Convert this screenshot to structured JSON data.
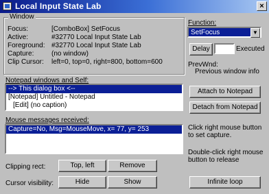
{
  "window": {
    "title": "Local Input State Lab",
    "close_glyph": "×"
  },
  "state_group": {
    "legend": "Window",
    "rows": [
      {
        "label": "Focus:",
        "value": "[ComboBox] SetFocus"
      },
      {
        "label": "Active:",
        "value": "#32770  Local Input State Lab"
      },
      {
        "label": "Foreground:",
        "value": "#32770  Local Input State Lab"
      },
      {
        "label": "Capture:",
        "value": "(no window)"
      },
      {
        "label": "Clip Cursor:",
        "value": "left=0, top=0, right=800, bottom=600"
      }
    ]
  },
  "function_panel": {
    "label": "Function:",
    "selected": "SetFocus",
    "delay_button": "Delay",
    "delay_value": "",
    "executed_label": "Executed",
    "prevwnd_label": "PrevWnd:",
    "prevwnd_value": "Previous window info"
  },
  "notepad_section": {
    "label": "Notepad windows and Self:",
    "items": [
      "--> This dialog box <--",
      "[Notepad] Untitled - Notepad",
      "  [Edit] (no caption)"
    ],
    "attach_button": "Attach to Notepad",
    "detach_button": "Detach from Notepad"
  },
  "mouse_section": {
    "label": "Mouse messages received:",
    "items": [
      "Capture=No, Msg=MouseMove, x=   77, y=  253"
    ],
    "hint_1": "Click right mouse button to set capture.",
    "hint_2": "Double-click right mouse button to release"
  },
  "bottom": {
    "clipping_label": "Clipping rect:",
    "topleft_button": "Top, left",
    "remove_button": "Remove",
    "cursor_label": "Cursor visibility:",
    "hide_button": "Hide",
    "show_button": "Show",
    "loop_button": "Infinite loop"
  },
  "colors": {
    "selection": "#0b1f96",
    "face": "#bfbfbf"
  }
}
